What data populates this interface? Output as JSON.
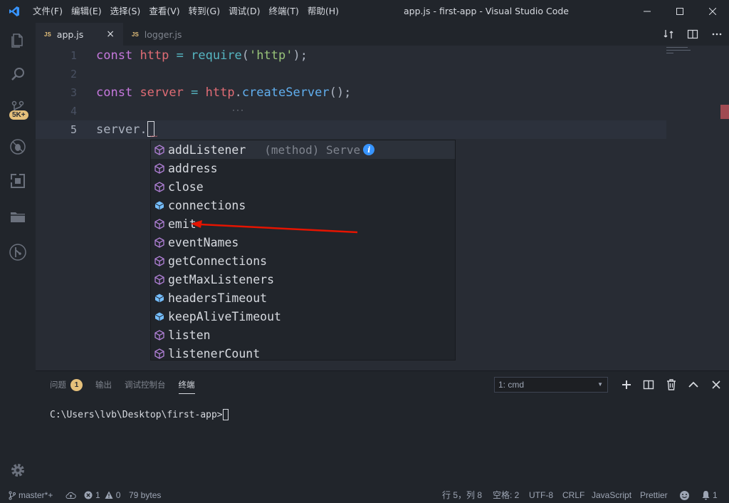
{
  "window": {
    "title": "app.js - first-app - Visual Studio Code",
    "menu": [
      "文件(F)",
      "编辑(E)",
      "选择(S)",
      "查看(V)",
      "转到(G)",
      "调试(D)",
      "终端(T)",
      "帮助(H)"
    ]
  },
  "activity": {
    "badge": "5K+"
  },
  "tabs": [
    {
      "icon": "JS",
      "label": "app.js",
      "active": true,
      "close": "×"
    },
    {
      "icon": "JS",
      "label": "logger.js",
      "active": false
    }
  ],
  "editor": {
    "line_numbers": [
      "1",
      "2",
      "3",
      "4",
      "5"
    ],
    "line1": {
      "kw": "const",
      "name": "http",
      "op": "=",
      "fn": "require",
      "open": "(",
      "str": "'http'",
      "close": ");"
    },
    "line3": {
      "kw": "const",
      "name": "server",
      "op": "=",
      "obj": "http",
      "dot": ".",
      "fn": "createServer",
      "call": "();"
    },
    "line5": {
      "text": "server."
    }
  },
  "suggestions": [
    {
      "label": "addListener",
      "kind": "method",
      "detail": "(method) Server.addL…"
    },
    {
      "label": "address",
      "kind": "method"
    },
    {
      "label": "close",
      "kind": "method"
    },
    {
      "label": "connections",
      "kind": "property"
    },
    {
      "label": "emit",
      "kind": "method"
    },
    {
      "label": "eventNames",
      "kind": "method"
    },
    {
      "label": "getConnections",
      "kind": "method"
    },
    {
      "label": "getMaxListeners",
      "kind": "method"
    },
    {
      "label": "headersTimeout",
      "kind": "property"
    },
    {
      "label": "keepAliveTimeout",
      "kind": "property"
    },
    {
      "label": "listen",
      "kind": "method"
    },
    {
      "label": "listenerCount",
      "kind": "method"
    }
  ],
  "suggest_info": "i",
  "panel": {
    "tabs": [
      {
        "label": "问题",
        "badge": "1"
      },
      {
        "label": "输出"
      },
      {
        "label": "调试控制台"
      },
      {
        "label": "终端",
        "active": true
      }
    ],
    "terminal_select": "1: cmd",
    "terminal_prompt": "C:\\Users\\lvb\\Desktop\\first-app>"
  },
  "status": {
    "branch": "master*+",
    "errors": "1",
    "warnings": "0",
    "size": "79 bytes",
    "position": "行 5，列 8",
    "indent": "空格: 2",
    "encoding": "UTF-8",
    "eol": "CRLF",
    "language": "JavaScript",
    "formatter": "Prettier",
    "notifications": "1"
  },
  "colors": {
    "method_icon": "#b180d7",
    "property_icon": "#75beff",
    "annotation_arrow": "#e51400",
    "badge": "#e5c07b"
  }
}
